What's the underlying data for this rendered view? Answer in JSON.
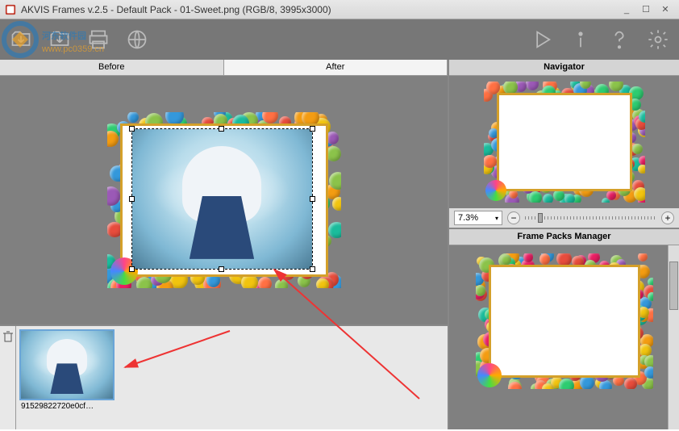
{
  "title": "AKVIS Frames v.2.5 - Default Pack - 01-Sweet.png (RGB/8, 3995x3000)",
  "watermark_text": "河东软件园",
  "watermark_url": "www.pc0359.cn",
  "tabs": {
    "before": "Before",
    "after": "After"
  },
  "navigator_label": "Navigator",
  "zoom_value": "7.3%",
  "packs_label": "Frame Packs Manager",
  "thumb_filename": "91529822720e0cf…",
  "window_buttons": {
    "min": "_",
    "max": "☐",
    "close": "✕"
  },
  "toolbar": {
    "open": "open",
    "save": "save",
    "print": "print",
    "share": "share",
    "run": "run",
    "info": "info",
    "help": "help",
    "settings": "settings"
  }
}
